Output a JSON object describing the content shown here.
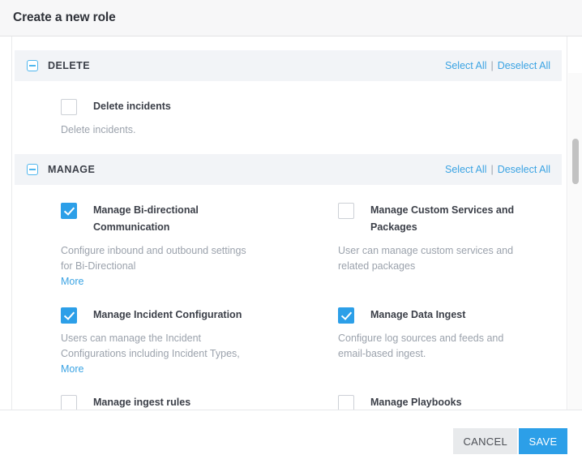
{
  "modal": {
    "title": "Create a new role"
  },
  "sections": [
    {
      "name": "DELETE",
      "collapse_icon": "minus-square-icon",
      "select_all_label": "Select All",
      "separator": "|",
      "deselect_all_label": "Deselect All",
      "permissions": [
        {
          "label": "Delete incidents",
          "description": "Delete incidents.",
          "checked": false,
          "more_label": ""
        }
      ]
    },
    {
      "name": "MANAGE",
      "collapse_icon": "minus-square-icon",
      "select_all_label": "Select All",
      "separator": "|",
      "deselect_all_label": "Deselect All",
      "permissions": [
        {
          "label": "Manage Bi-directional Communication",
          "description": "Configure inbound and outbound settings for Bi-Directional",
          "checked": true,
          "more_label": "More"
        },
        {
          "label": "Manage Custom Services and Packages",
          "description": "User can manage custom services and related packages",
          "checked": false,
          "more_label": ""
        },
        {
          "label": "Manage Incident Configuration",
          "description": "Users can manage the Incident Configurations including Incident Types,",
          "checked": true,
          "more_label": "More"
        },
        {
          "label": "Manage Data Ingest",
          "description": "Configure log sources and feeds and email-based ingest.",
          "checked": true,
          "more_label": ""
        },
        {
          "label": "Manage ingest rules",
          "description": "",
          "checked": false,
          "more_label": ""
        },
        {
          "label": "Manage Playbooks",
          "description": "",
          "checked": false,
          "more_label": ""
        }
      ]
    }
  ],
  "footer": {
    "cancel_label": "CANCEL",
    "save_label": "SAVE"
  },
  "colors": {
    "accent": "#2c9fe8",
    "link": "#3aa3e3",
    "section_header_bg": "#f2f4f7",
    "muted_text": "#9ba2ac"
  }
}
